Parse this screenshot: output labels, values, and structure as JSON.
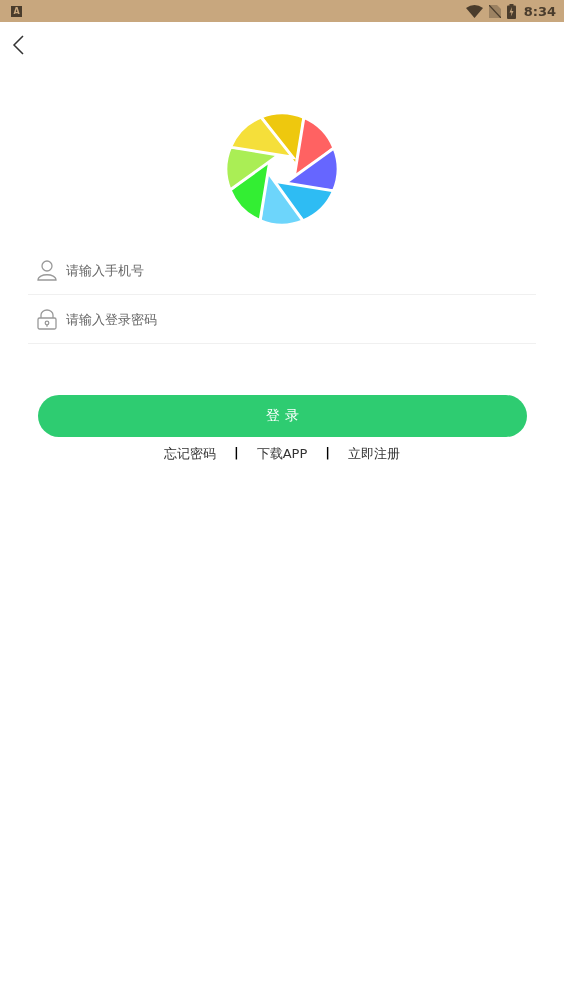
{
  "status_bar": {
    "time": "8:34",
    "notification": "A"
  },
  "fields": [
    {
      "kind": "phone",
      "placeholder": "请输入手机号"
    },
    {
      "kind": "password",
      "placeholder": "请输入登录密码"
    }
  ],
  "login_button": "登 录",
  "footer": [
    {
      "kind": "link",
      "text": "忘记密码"
    },
    {
      "kind": "separator",
      "text": "|"
    },
    {
      "kind": "link",
      "text": "下载APP"
    },
    {
      "kind": "separator",
      "text": "|"
    },
    {
      "kind": "link",
      "text": "立即注册"
    }
  ]
}
